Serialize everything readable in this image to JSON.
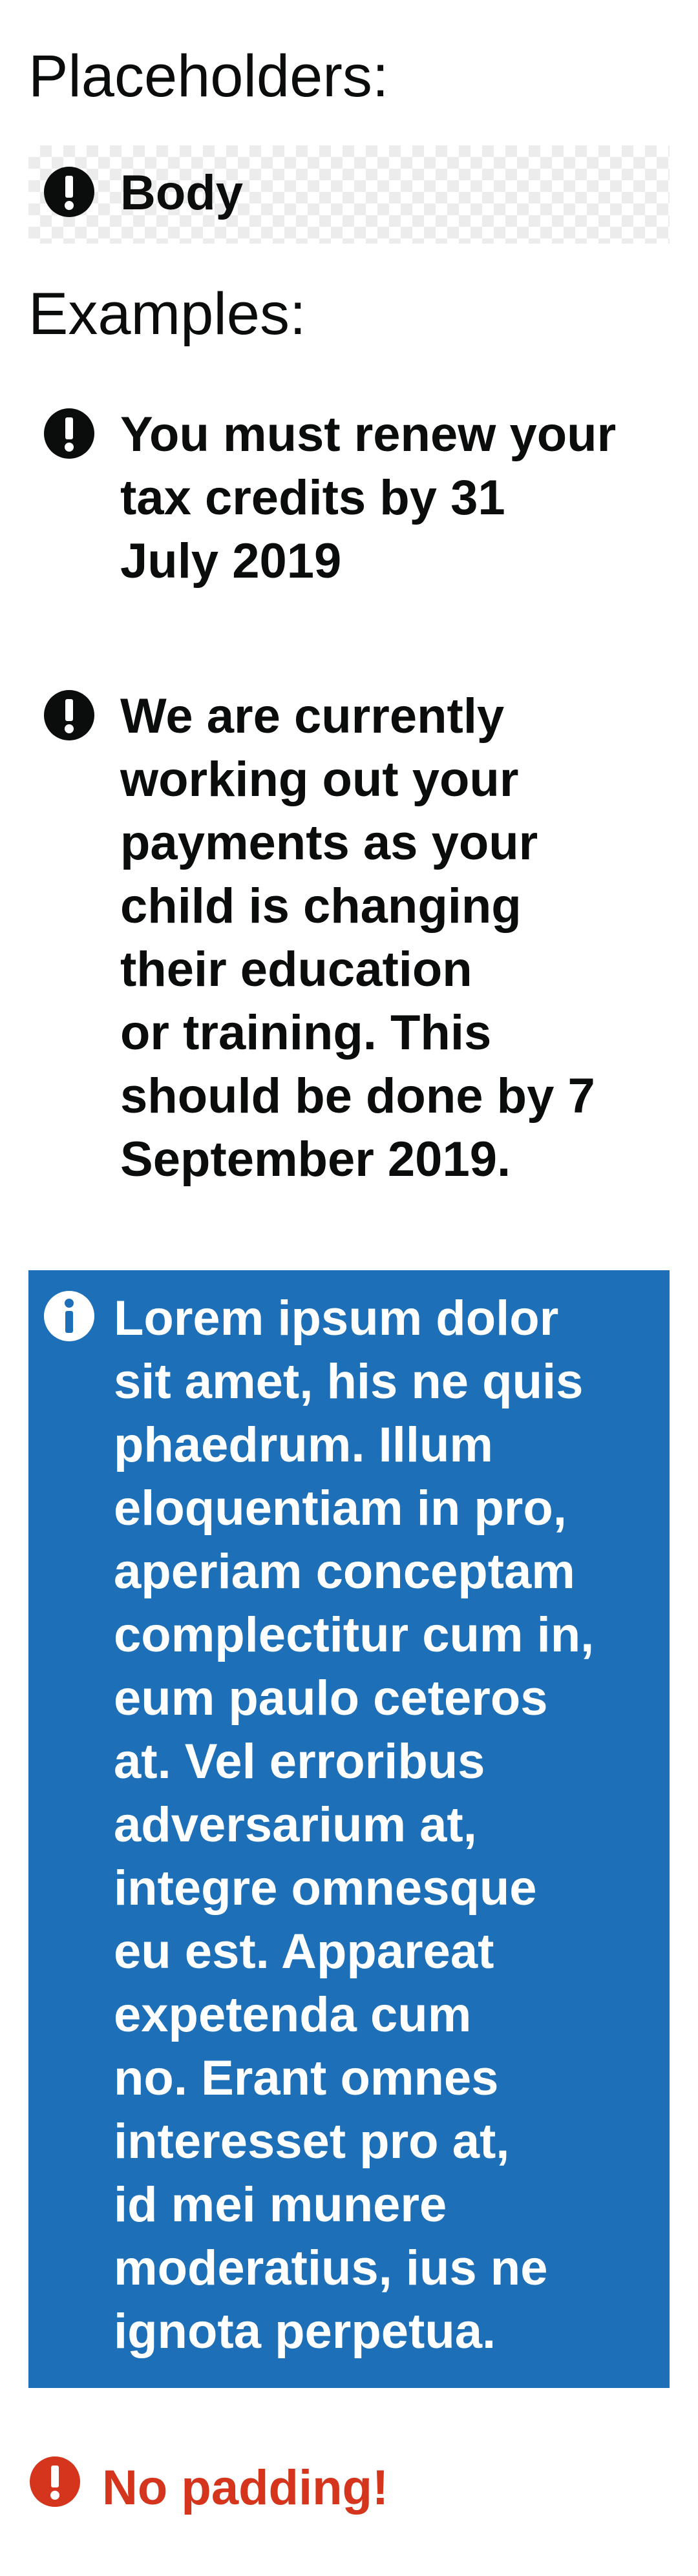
{
  "sections": {
    "placeholders_title": "Placeholders:",
    "examples_title": "Examples:"
  },
  "placeholder": {
    "text": "Body",
    "icon": "exclamation-circle-icon"
  },
  "examples": [
    {
      "text": "You must renew your\ntax credits by 31\nJuly 2019",
      "icon": "exclamation-circle-icon"
    },
    {
      "text": "We are currently\nworking out your\npayments as your\nchild is changing\ntheir education\nor training. This\nshould be done by 7\nSeptember 2019.",
      "icon": "exclamation-circle-icon"
    }
  ],
  "info_panel": {
    "text": "Lorem ipsum dolor\nsit amet, his ne quis\nphaedrum. Illum\neloquentiam in pro,\naperiam conceptam\ncomplectitur cum in,\neum paulo ceteros\nat. Vel erroribus\nadversarium at,\nintegre omnesque\neu est. Appareat\nexpetenda cum\nno. Erant omnes\ninteresset pro at,\nid mei munere\nmoderatius, ius ne\nignota perpetua.",
    "icon": "info-circle-icon",
    "background": "#1d70b8",
    "text_color": "#ffffff"
  },
  "no_padding": {
    "text": "No padding!",
    "icon": "exclamation-circle-icon",
    "color": "#d4351c"
  }
}
